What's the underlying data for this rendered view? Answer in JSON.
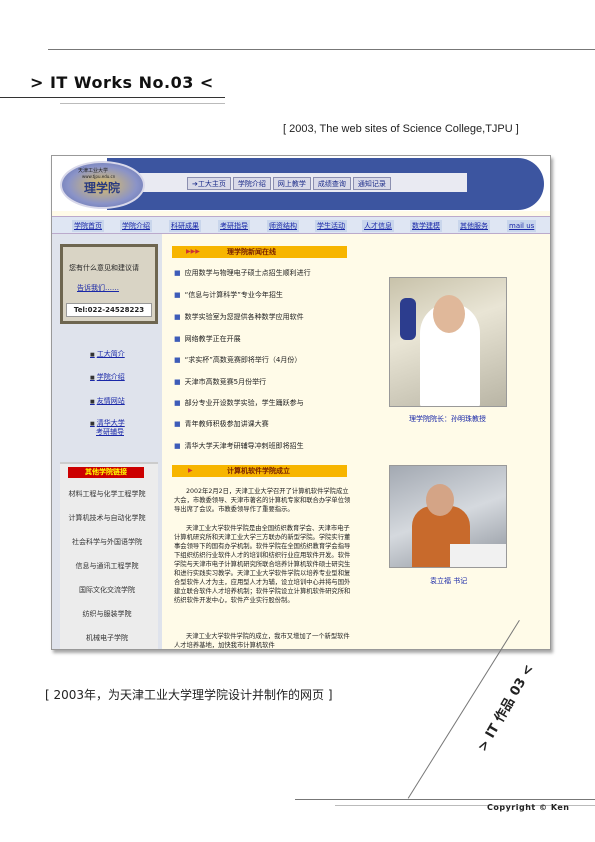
{
  "page": {
    "works_title": "> IT Works No.03 <",
    "caption_en": "[ 2003, The web sites of Science College,TJPU ]",
    "caption_cn": "[ 2003年，为天津工业大学理学院设计并制作的网页 ]",
    "side_label": "> IT 作品 03 <",
    "copyright": "Copyright © Ken"
  },
  "site": {
    "logo": {
      "top_text": "天津工业大学",
      "url_text": "www.tjpu.edu.cn",
      "main_text": "理学院"
    },
    "topnav": [
      {
        "label": "➔工大主页"
      },
      {
        "label": "学院介绍"
      },
      {
        "label": "网上教学"
      },
      {
        "label": "成绩查询"
      },
      {
        "label": "通知记录"
      }
    ],
    "mainnav": [
      {
        "label": "学院首页"
      },
      {
        "label": "学院介绍"
      },
      {
        "label": "科研成果"
      },
      {
        "label": "考研指导"
      },
      {
        "label": "师资结构"
      },
      {
        "label": "学生活动"
      },
      {
        "label": "人才信息"
      },
      {
        "label": "数学建模"
      },
      {
        "label": "其他服务"
      },
      {
        "label": "mail us"
      }
    ],
    "contact": {
      "question": "您有什么意见和建议请",
      "link": "告诉我们……",
      "tel": "Tel:022-24528223"
    },
    "side_links": [
      {
        "label": "工大简介"
      },
      {
        "label": "学院介绍"
      },
      {
        "label": "友情网站"
      },
      {
        "label": "清华大学"
      },
      {
        "label": "考研辅导"
      }
    ],
    "other_colleges": {
      "heading": "其他学院链接",
      "items": [
        {
          "label": "材料工程与化学工程学院"
        },
        {
          "label": "计算机技术与自动化学院"
        },
        {
          "label": "社会科学与外国语学院"
        },
        {
          "label": "信息与通讯工程学院"
        },
        {
          "label": "国际文化交流学院"
        },
        {
          "label": "纺织与服装学院"
        },
        {
          "label": "机械电子学院"
        }
      ]
    },
    "news": {
      "heading": "理学院新闻在线",
      "items": [
        {
          "text": "应用数学与物理电子硕士点招生顺利进行"
        },
        {
          "text": "“信息与计算科学”专业今年招生"
        },
        {
          "text": "数学实验室为您提供各种数学应用软件"
        },
        {
          "text": "网络教学正在开展"
        },
        {
          "text": "“求实杯”高数竞赛即将举行（4月份）"
        },
        {
          "text": "天津市高数竞赛5月份举行"
        },
        {
          "text": "部分专业开设数学实验，学生踊跃参与"
        },
        {
          "text": "青年教师积极参加讲课大赛"
        },
        {
          "text": "清华大学天津考研辅导冲刺班即将招生"
        }
      ]
    },
    "dean_caption": "理学院院长：孙明珠教授",
    "college_section": {
      "heading": "计算机软件学院成立",
      "paragraphs": [
        "2002年2月2日，天津工业大学召开了计算机软件学院成立大会，市教委领导、天津市著名的计算机专家和联合办学单位领导出席了会议。市教委领导作了重要指示。",
        "天津工业大学软件学院是由全国纺织教育学会、天津市电子计算机研究所和天津工业大学三方联办的新型学院。学院实行董事会领导下的国有办学机制。软件学院在全国纺织教育学会指导下组织纺织行业软件人才的培训和纺织行业应用软件开发。软件学院与天津市电子计算机研究所联合培养计算机软件硕士研究生和进行实践实习教学。天津工业大学软件学院以培养专业型和复合型软件人才为主，应用型人才为辅，设立培训中心并将与国外建立联合软件人才培养机制；软件学院设立计算机软件研究所和纺织软件开发中心，软件产业实行股份制。",
        "天津工业大学软件学院的成立，我市又增加了一个新型软件人才培养基地，加快我市计算机软件"
      ]
    },
    "secretary_caption": "袁立福 书记"
  },
  "colors": {
    "header_blue": "#3c55a0",
    "link_blue": "#1a28a8",
    "orange_head": "#f7b500",
    "red_head": "#cc0000",
    "page_bg": "#fffbe8"
  }
}
